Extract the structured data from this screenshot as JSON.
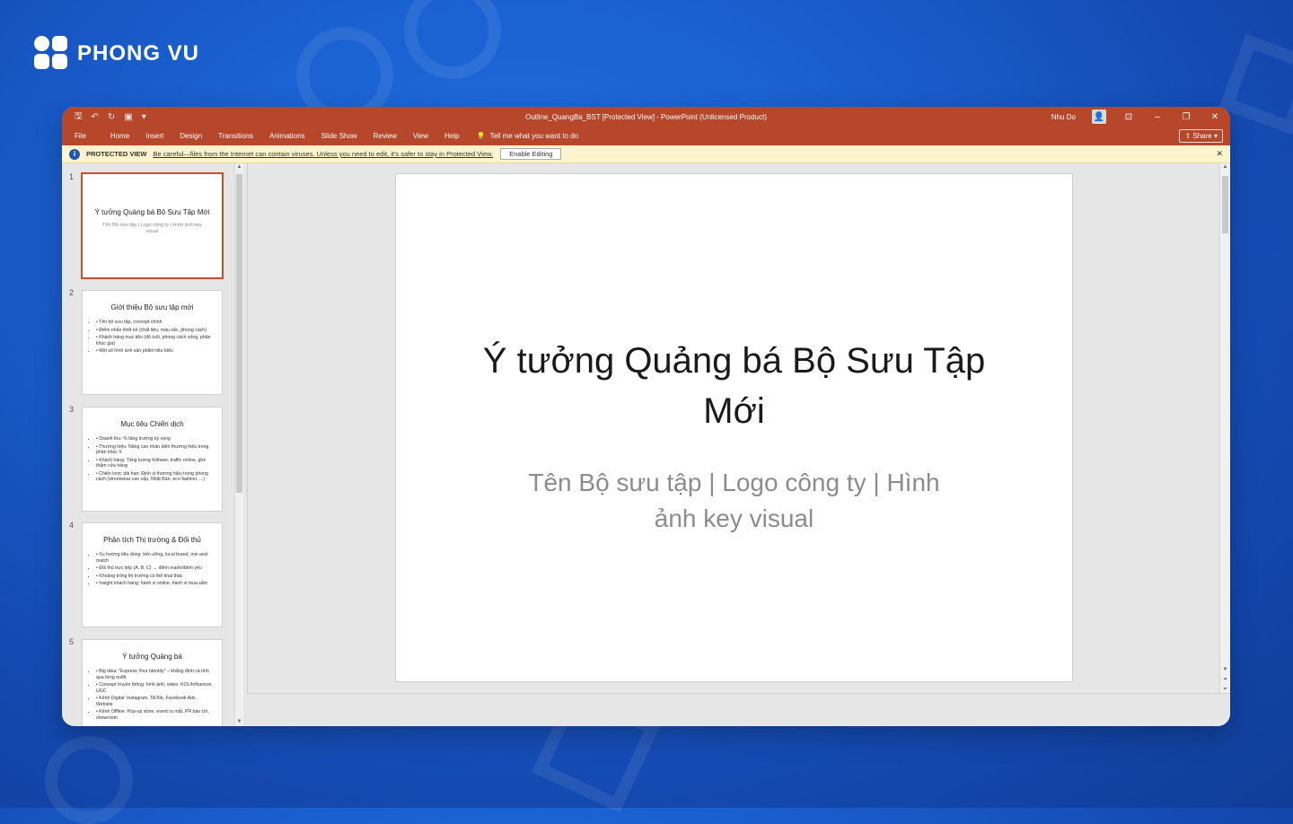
{
  "brand": {
    "name": "PHONG VU"
  },
  "window": {
    "title": "Outline_QuangBa_BST [Protected View]  -  PowerPoint (Unlicensed Product)",
    "user": "Nhu Do",
    "share_label": "Share"
  },
  "ribbon": {
    "tabs": [
      "File",
      "Home",
      "Insert",
      "Design",
      "Transitions",
      "Animations",
      "Slide Show",
      "Review",
      "View",
      "Help"
    ],
    "tellme": "Tell me what you want to do"
  },
  "protected_view": {
    "label": "PROTECTED VIEW",
    "message": "Be careful—files from the Internet can contain viruses. Unless you need to edit, it's safer to stay in Protected View.",
    "button": "Enable Editing"
  },
  "thumbnails": [
    {
      "num": "1",
      "title": "Ý tưởng Quảng bá Bộ Sưu Tập Mới",
      "subtitle": "Tên Bộ sưu tập | Logo công ty | Hình ảnh key visual"
    },
    {
      "num": "2",
      "title": "Giới thiệu Bộ sưu tập mới",
      "bullets": [
        "• Tên bộ sưu tập, concept chính",
        "• Điểm nhấn thiết kế (chất liệu, màu sắc, phong cách)",
        "• Khách hàng mục tiêu (độ tuổi, phong cách sống, phân khúc giá)",
        "• Một số hình ảnh sản phẩm tiêu biểu"
      ]
    },
    {
      "num": "3",
      "title": "Mục tiêu Chiến dịch",
      "bullets": [
        "• Doanh thu: % tăng trưởng kỳ vọng",
        "• Thương hiệu: Nâng cao nhận diện thương hiệu trong phân khúc X",
        "• Khách hàng: Tăng lượng follower, traffic online, ghé thăm cửa hàng",
        "• Chiến lược dài hạn: Định vị thương hiệu trong phong cách (streetwear cao cấp, Nhật Bản, eco-fashion, ...)"
      ]
    },
    {
      "num": "4",
      "title": "Phân tích Thị trường & Đối thủ",
      "bullets": [
        "• Xu hướng tiêu dùng: bền vững, local brand, mix-and-match",
        "• Đối thủ trực tiếp (A, B, C) → điểm mạnh/điểm yếu",
        "• Khoảng trống thị trường có thể khai thác",
        "• Insight khách hàng: hành vi online, hành vi mua sắm"
      ]
    },
    {
      "num": "5",
      "title": "Ý tưởng Quảng bá",
      "bullets": [
        "• Big Idea: \"Express Your Identity\" – khẳng định cá tính qua từng outfit",
        "• Concept truyền thông: hình ảnh, video, KOL/Influencer, UGC",
        "• Kênh Digital: Instagram, TikTok, Facebook Ads, Website",
        "• Kênh Offline: Pop-up store, event ra mắt, PR báo chí, showroom"
      ]
    }
  ],
  "slide": {
    "title_line1": "Ý tưởng Quảng bá Bộ Sưu Tập",
    "title_line2": "Mới",
    "subtitle_line1": "Tên Bộ sưu tập | Logo công ty | Hình",
    "subtitle_line2": "ảnh key visual"
  },
  "colors": {
    "accent": "#b7472a",
    "banner": "#fff4ce",
    "background": "#1a5fcf"
  }
}
